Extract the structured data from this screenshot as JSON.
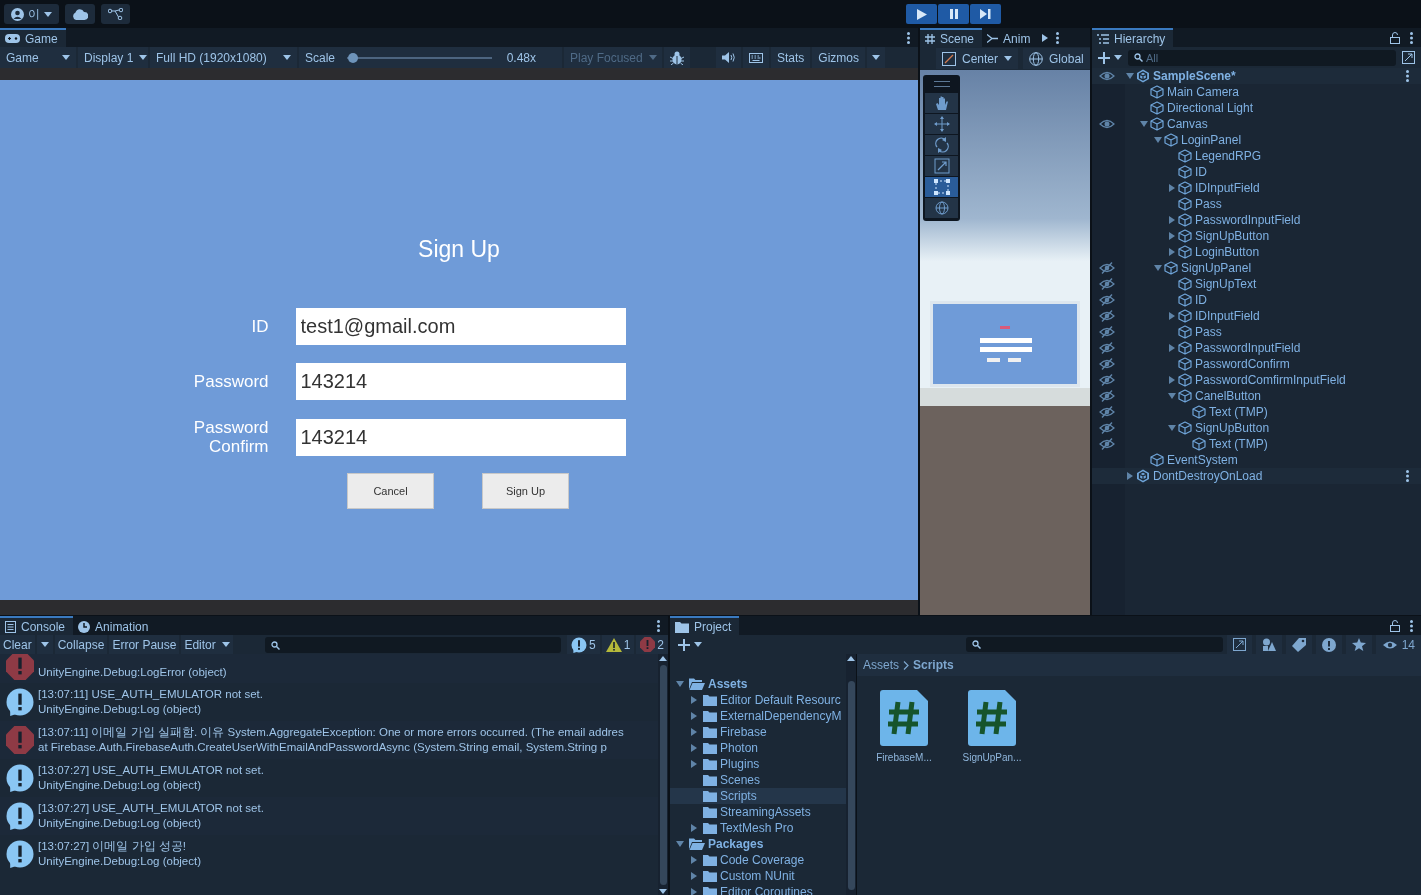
{
  "top_bar": {
    "account": "이"
  },
  "game": {
    "tabs": [
      {
        "label": "Game",
        "selected": true
      }
    ],
    "toolbar": {
      "view": "Game",
      "display": "Display 1",
      "resolution": "Full HD (1920x1080)",
      "scale_label": "Scale",
      "scale": {
        "level": 0.04
      },
      "scale_reading": "0.48x",
      "play_focused": {
        "label": "Play Focused",
        "disabled": true
      },
      "stats": "Stats",
      "gizmos": "Gizmos"
    },
    "screen": {
      "title": "Sign Up",
      "fields": [
        {
          "label": "ID",
          "value": "test1@gmail.com"
        },
        {
          "label": "Password",
          "value": "143214"
        },
        {
          "label": "Password Confirm",
          "value": "143214"
        }
      ],
      "buttons": [
        "Cancel",
        "Sign Up"
      ]
    }
  },
  "scene": {
    "tabs": [
      {
        "label": "Scene",
        "selected": true
      },
      {
        "label": "Anim",
        "selected": false
      }
    ],
    "pivot": "Center",
    "space": "Global",
    "tools": [
      {
        "kind": "hand",
        "selected": false
      },
      {
        "kind": "move",
        "selected": false
      },
      {
        "kind": "rotate",
        "selected": false
      },
      {
        "kind": "scale",
        "selected": false
      },
      {
        "kind": "rect",
        "selected": true
      },
      {
        "kind": "transform",
        "selected": false
      }
    ]
  },
  "hierarchy": {
    "title": "Hierarchy",
    "search_placeholder": "All",
    "tree": [
      {
        "label": "SampleScene*",
        "kind": "scene",
        "active": true,
        "expanded": true,
        "hidden": false,
        "children": [
          {
            "label": "Main Camera",
            "kind": "object"
          },
          {
            "label": "Directional Light",
            "kind": "object"
          },
          {
            "label": "Canvas",
            "kind": "object",
            "expanded": true,
            "hidden": false,
            "children": [
              {
                "label": "LoginPanel",
                "kind": "object",
                "expanded": true,
                "children": [
                  {
                    "label": "LegendRPG",
                    "kind": "object"
                  },
                  {
                    "label": "ID",
                    "kind": "object"
                  },
                  {
                    "label": "IDInputField",
                    "kind": "object",
                    "expanded": false
                  },
                  {
                    "label": "Pass",
                    "kind": "object"
                  },
                  {
                    "label": "PasswordInputField",
                    "kind": "object",
                    "expanded": false
                  },
                  {
                    "label": "SignUpButton",
                    "kind": "object",
                    "expanded": false
                  },
                  {
                    "label": "LoginButton",
                    "kind": "object",
                    "expanded": false
                  }
                ]
              },
              {
                "label": "SignUpPanel",
                "kind": "object",
                "expanded": true,
                "hidden": true,
                "children": [
                  {
                    "label": "SignUpText",
                    "kind": "object",
                    "hidden": true
                  },
                  {
                    "label": "ID",
                    "kind": "object",
                    "hidden": true
                  },
                  {
                    "label": "IDInputField",
                    "kind": "object",
                    "expanded": false,
                    "hidden": true
                  },
                  {
                    "label": "Pass",
                    "kind": "object",
                    "hidden": true
                  },
                  {
                    "label": "PasswordInputField",
                    "kind": "object",
                    "expanded": false,
                    "hidden": true
                  },
                  {
                    "label": "PasswordConfirm",
                    "kind": "object",
                    "hidden": true
                  },
                  {
                    "label": "PasswordComfirmInputField",
                    "kind": "object",
                    "expanded": false,
                    "hidden": true
                  },
                  {
                    "label": "CanelButton",
                    "kind": "object",
                    "expanded": true,
                    "hidden": true,
                    "children": [
                      {
                        "label": "Text (TMP)",
                        "kind": "object",
                        "hidden": true
                      }
                    ]
                  },
                  {
                    "label": "SignUpButton",
                    "kind": "object",
                    "expanded": true,
                    "hidden": true,
                    "children": [
                      {
                        "label": "Text (TMP)",
                        "kind": "object",
                        "hidden": true
                      }
                    ]
                  }
                ]
              }
            ]
          },
          {
            "label": "EventSystem",
            "kind": "object"
          }
        ]
      },
      {
        "label": "DontDestroyOnLoad",
        "kind": "scene",
        "active": false,
        "expanded": false
      }
    ]
  },
  "console": {
    "tabs": [
      {
        "label": "Console",
        "kind": "console",
        "selected": true
      },
      {
        "label": "Animation",
        "kind": "animation",
        "selected": false
      }
    ],
    "toolbar": {
      "clear": "Clear",
      "collapse": "Collapse",
      "error_pause": "Error Pause",
      "editor": "Editor"
    },
    "counts": {
      "info": "5",
      "warning": "1",
      "error": "2"
    },
    "entries": [
      {
        "kind": "error",
        "cut": true,
        "lines": [
          "UnityEngine.Debug:LogError (object)"
        ]
      },
      {
        "kind": "log",
        "cut": false,
        "lines": [
          "[13:07:11] USE_AUTH_EMULATOR not set.",
          "UnityEngine.Debug:Log (object)"
        ]
      },
      {
        "kind": "error",
        "cut": false,
        "lines": [
          "[13:07:11] 이메일 가입 실패함. 이유 System.AggregateException: One or more errors occurred. (The email addres",
          " at Firebase.Auth.FirebaseAuth.CreateUserWithEmailAndPasswordAsync (System.String email, System.String p"
        ]
      },
      {
        "kind": "log",
        "cut": false,
        "lines": [
          "[13:07:27] USE_AUTH_EMULATOR not set.",
          "UnityEngine.Debug:Log (object)"
        ]
      },
      {
        "kind": "log",
        "cut": false,
        "lines": [
          "[13:07:27] USE_AUTH_EMULATOR not set.",
          "UnityEngine.Debug:Log (object)"
        ]
      },
      {
        "kind": "log",
        "cut": false,
        "lines": [
          "[13:07:27] 이메일 가입 성공!",
          "UnityEngine.Debug:Log (object)"
        ]
      }
    ]
  },
  "project": {
    "title": "Project",
    "hidden_count": "14",
    "tree": [
      {
        "label": "Assets",
        "expanded": true,
        "selected": false,
        "children": [
          {
            "label": "Editor Default Resourc",
            "expanded": false,
            "selected": false
          },
          {
            "label": "ExternalDependencyM",
            "expanded": false,
            "selected": false
          },
          {
            "label": "Firebase",
            "expanded": false,
            "selected": false
          },
          {
            "label": "Photon",
            "expanded": false,
            "selected": false
          },
          {
            "label": "Plugins",
            "expanded": false,
            "selected": false
          },
          {
            "label": "Scenes",
            "selected": false
          },
          {
            "label": "Scripts",
            "selected": true
          },
          {
            "label": "StreamingAssets",
            "selected": false
          },
          {
            "label": "TextMesh Pro",
            "expanded": false,
            "selected": false
          }
        ]
      },
      {
        "label": "Packages",
        "expanded": true,
        "selected": false,
        "children": [
          {
            "label": "Code Coverage",
            "expanded": false,
            "selected": false
          },
          {
            "label": "Custom NUnit",
            "expanded": false,
            "selected": false
          },
          {
            "label": "Editor Coroutines",
            "expanded": false,
            "selected": false
          }
        ]
      }
    ],
    "breadcrumb": [
      "Assets",
      "Scripts"
    ],
    "files": [
      {
        "name": "FirebaseM..."
      },
      {
        "name": "SignUpPan..."
      }
    ]
  }
}
